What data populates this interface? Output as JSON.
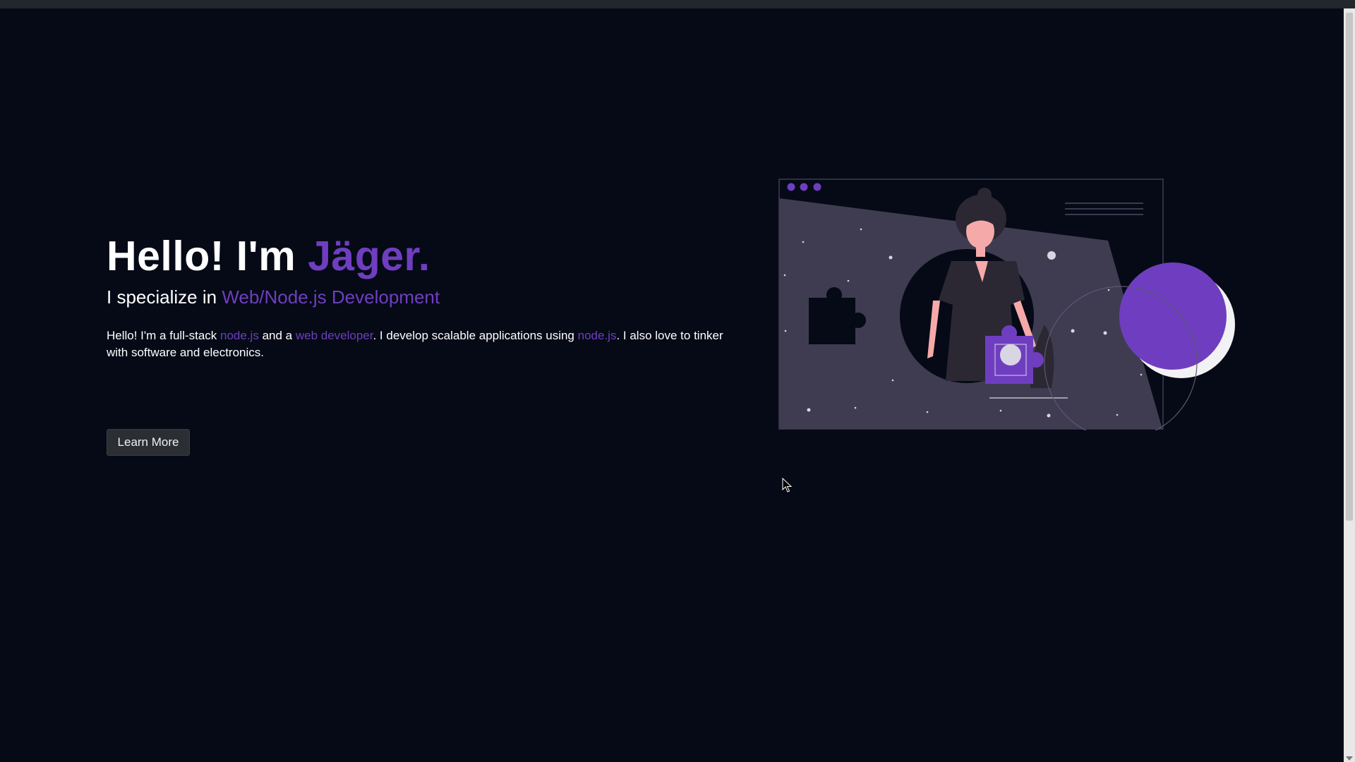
{
  "hero": {
    "title_prefix": "Hello! I'm ",
    "title_name": "Jäger.",
    "subtitle_prefix": "I specialize in ",
    "subtitle_highlight": "Web/Node.js Development",
    "description": {
      "part1": "Hello! I'm a full-stack ",
      "link1": "node.js",
      "part2": " and a ",
      "link2": "web developer",
      "part3": ". I develop scalable applications using ",
      "link3": "node.js",
      "part4": ". I also love to tinker with software and electronics."
    },
    "cta_label": "Learn More"
  },
  "illustration": {
    "icon": "developer-illustration"
  },
  "colors": {
    "background": "#050a16",
    "accent": "#6f3ec0",
    "button": "#2b2e33"
  }
}
